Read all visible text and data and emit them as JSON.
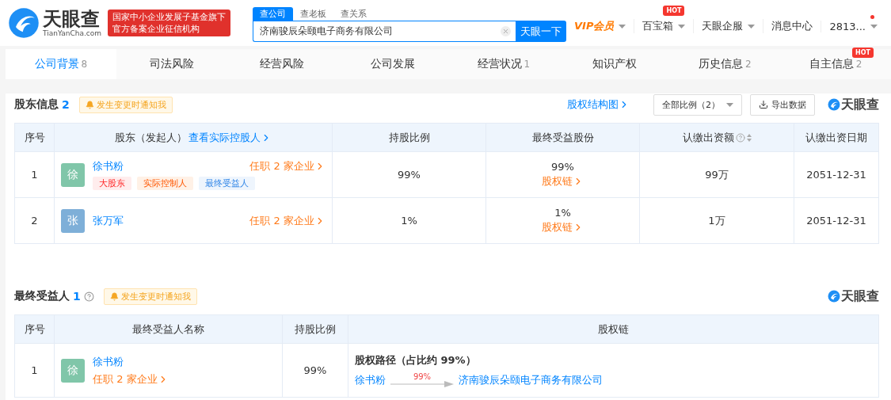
{
  "header": {
    "logo": {
      "name": "天眼查",
      "domain": "TianYanCha.com"
    },
    "banner": [
      "国家中小企业发展子基金旗下",
      "官方备案企业征信机构"
    ],
    "search": {
      "tabs": [
        {
          "label": "查公司",
          "selected": true
        },
        {
          "label": "查老板",
          "selected": false
        },
        {
          "label": "查关系",
          "selected": false
        }
      ],
      "value": "济南骏辰朵颐电子商务有限公司",
      "button": "天眼一下"
    },
    "nav": [
      {
        "label": "VIP会员",
        "kind": "vip",
        "dropdown": true,
        "dot": false
      },
      {
        "label": "百宝箱",
        "kind": "plain",
        "dropdown": true,
        "badge": "HOT",
        "dot": false
      },
      {
        "label": "天眼企服",
        "kind": "plain",
        "dropdown": true,
        "dot": false
      },
      {
        "label": "消息中心",
        "kind": "plain",
        "dropdown": false,
        "dot": false
      },
      {
        "label": "2813...",
        "kind": "plain",
        "dropdown": true,
        "dot": true
      }
    ]
  },
  "tabs": [
    {
      "label": "公司背景",
      "count": "8",
      "selected": true
    },
    {
      "label": "司法风险",
      "selected": false
    },
    {
      "label": "经营风险",
      "selected": false
    },
    {
      "label": "公司发展",
      "selected": false
    },
    {
      "label": "经营状况",
      "count": "1",
      "selected": false
    },
    {
      "label": "知识产权",
      "selected": false
    },
    {
      "label": "历史信息",
      "count": "2",
      "selected": false
    },
    {
      "label": "自主信息",
      "count": "2",
      "badge": "HOT",
      "selected": false
    }
  ],
  "shareholders": {
    "title": "股东信息",
    "count": "2",
    "notify": "发生变更时通知我",
    "structure_link": "股权结构图",
    "filter": "全部比例（2）",
    "export": "导出数据",
    "brand": "天眼查",
    "columns": [
      {
        "label": "序号",
        "help": false,
        "sortable": false
      },
      {
        "label": "股东（发起人）",
        "link": "查看实际控股人",
        "help": false,
        "sortable": false
      },
      {
        "label": "持股比例",
        "help": false,
        "sortable": false
      },
      {
        "label": "最终受益股份",
        "help": false,
        "sortable": false
      },
      {
        "label": "认缴出资额",
        "help": true,
        "sortable": true
      },
      {
        "label": "认缴出资日期",
        "help": false,
        "sortable": false
      }
    ],
    "rows": [
      {
        "index": "1",
        "avatar": "徐",
        "color": "#80c6a9",
        "name": "徐书粉",
        "positions": "任职 2 家企业",
        "tags": [
          {
            "label": "大股东",
            "color": "#ffeded"
          },
          {
            "label": "实际控制人",
            "color": "#fff1e6"
          },
          {
            "label": "最终受益人",
            "color": "#eef5fd"
          }
        ],
        "ratio": "99%",
        "final_share": "99%",
        "chain_link": "股权链",
        "amount": "99万",
        "date": "2051-12-31"
      },
      {
        "index": "2",
        "avatar": "张",
        "color": "#7eafd8",
        "name": "张万军",
        "positions": "任职 2 家企业",
        "tags": [],
        "ratio": "1%",
        "final_share": "1%",
        "chain_link": "股权链",
        "amount": "1万",
        "date": "2051-12-31"
      }
    ]
  },
  "beneficiaries": {
    "title": "最终受益人",
    "count": "1",
    "notify": "发生变更时通知我",
    "brand": "天眼查",
    "columns": [
      "序号",
      "最终受益人名称",
      "持股比例",
      "股权链"
    ],
    "rows": [
      {
        "index": "1",
        "avatar": "徐",
        "color": "#80c6a9",
        "name": "徐书粉",
        "positions": "任职 2 家企业",
        "ratio": "99%",
        "path_title": "股权路径（占比约 99%）",
        "path": {
          "from": "徐书粉",
          "percent": "99%",
          "to": "济南骏辰朵颐电子商务有限公司"
        }
      }
    ]
  }
}
